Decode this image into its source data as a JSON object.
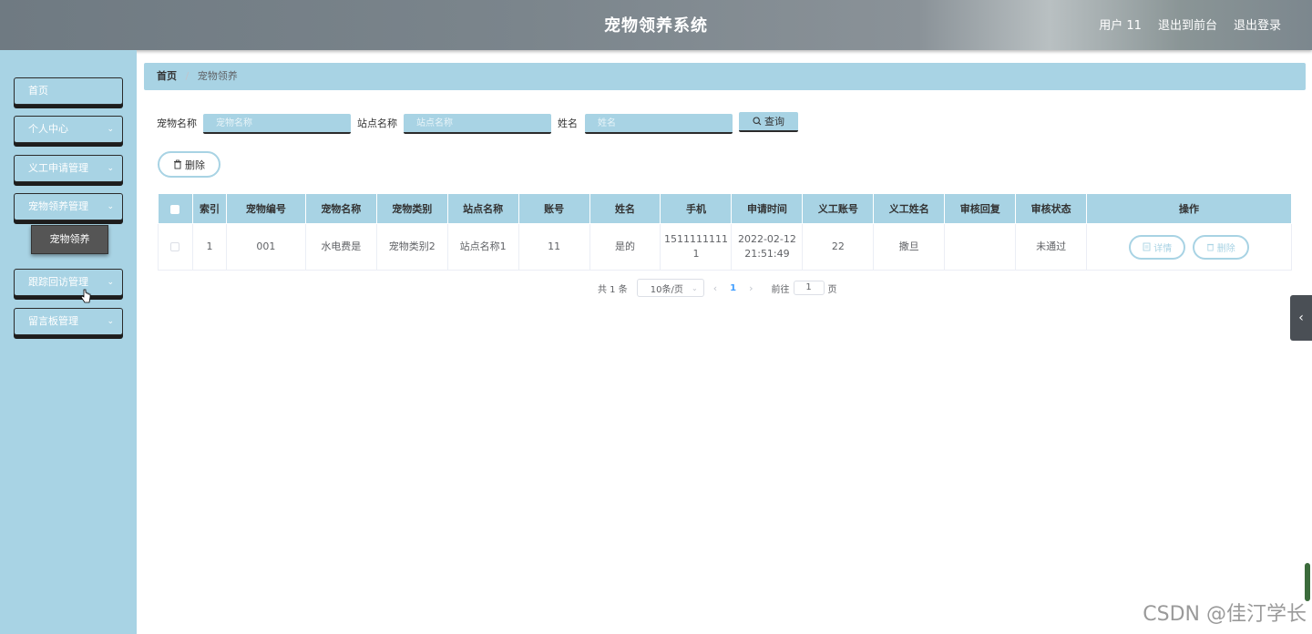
{
  "header": {
    "title": "宠物领养系统",
    "user": "用户 11",
    "back_link": "退出到前台",
    "logout": "退出登录"
  },
  "sidebar": {
    "items": [
      {
        "label": "首页"
      },
      {
        "label": "个人中心"
      },
      {
        "label": "义工申请管理"
      },
      {
        "label": "宠物领养管理"
      },
      {
        "label": "跟踪回访管理"
      },
      {
        "label": "留言板管理"
      }
    ],
    "popup": "宠物领养"
  },
  "breadcrumb": {
    "home": "首页",
    "separator": "/",
    "current": "宠物领养"
  },
  "search": {
    "pet_name_label": "宠物名称",
    "pet_name_placeholder": "宠物名称",
    "station_label": "站点名称",
    "station_placeholder": "站点名称",
    "name_label": "姓名",
    "name_placeholder": "姓名",
    "query_button": "查询"
  },
  "actions": {
    "delete_label": "删除"
  },
  "table": {
    "headers": [
      "索引",
      "宠物编号",
      "宠物名称",
      "宠物类别",
      "站点名称",
      "账号",
      "姓名",
      "手机",
      "申请时间",
      "义工账号",
      "义工姓名",
      "审核回复",
      "审核状态",
      "操作"
    ],
    "rows": [
      {
        "index": "1",
        "pet_id": "001",
        "pet_name": "水电费是",
        "category": "宠物类别2",
        "station": "站点名称1",
        "account": "11",
        "name": "是的",
        "phone_line1": "1511111111",
        "phone_line2": "1",
        "time_line1": "2022-02-12",
        "time_line2": "21:51:49",
        "volunteer_account": "22",
        "volunteer_name": "撒旦",
        "review_reply": "",
        "review_status": "未通过",
        "detail_label": "详情",
        "delete_label": "删除"
      }
    ]
  },
  "pagination": {
    "total": "共 1 条",
    "page_size": "10条/页",
    "current_page": "1",
    "goto_label": "前往",
    "goto_value": "1",
    "page_suffix": "页"
  },
  "watermark": "CSDN @佳汀学长",
  "colors": {
    "accent": "#a8d3e4",
    "header": "#7b858c"
  }
}
